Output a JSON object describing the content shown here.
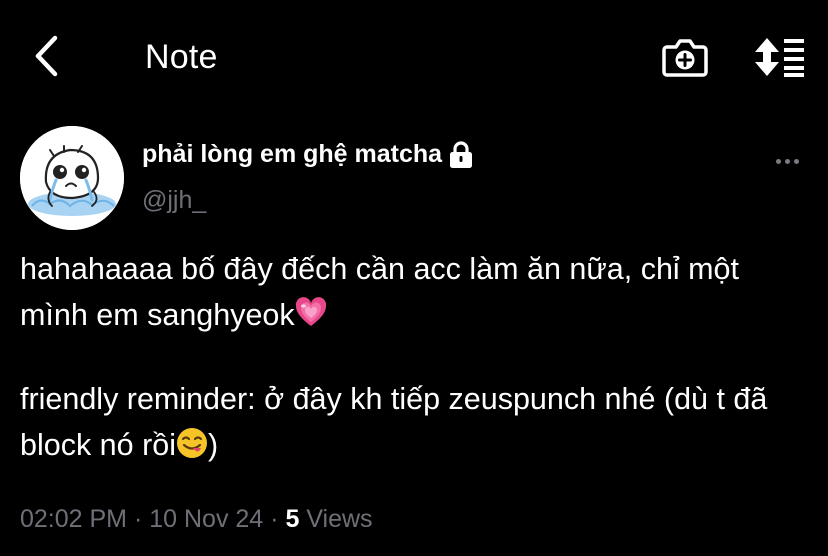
{
  "header": {
    "title": "Note",
    "back_icon": "chevron-left-icon",
    "camera_icon": "camera-plus-icon",
    "sort_icon": "sort-arrows-icon"
  },
  "post": {
    "author": {
      "display_name": "phải lòng em ghệ matcha",
      "handle": "@jjh_",
      "lock_icon": "lock-icon",
      "avatar": "crying-cartoon-avatar"
    },
    "more_icon": "more-dots-icon",
    "paragraphs": [
      {
        "text": "hahahaaaa bố đây đếch cần acc làm ăn nữa, chỉ một mình em sanghyeok",
        "emoji": "pink-heart-emoji"
      },
      {
        "text": "friendly reminder: ở đây kh tiếp zeuspunch nhé (dù t đã block nó rồi",
        "emoji": "yum-face-emoji",
        "suffix": ")"
      }
    ],
    "time": "02:02 PM",
    "separator": "·",
    "date": "10 Nov 24",
    "views_count": "5",
    "views_label": "Views"
  },
  "colors": {
    "background": "#000000",
    "text": "#ffffff",
    "muted": "#6f6f78",
    "heart": "#e8488a"
  }
}
